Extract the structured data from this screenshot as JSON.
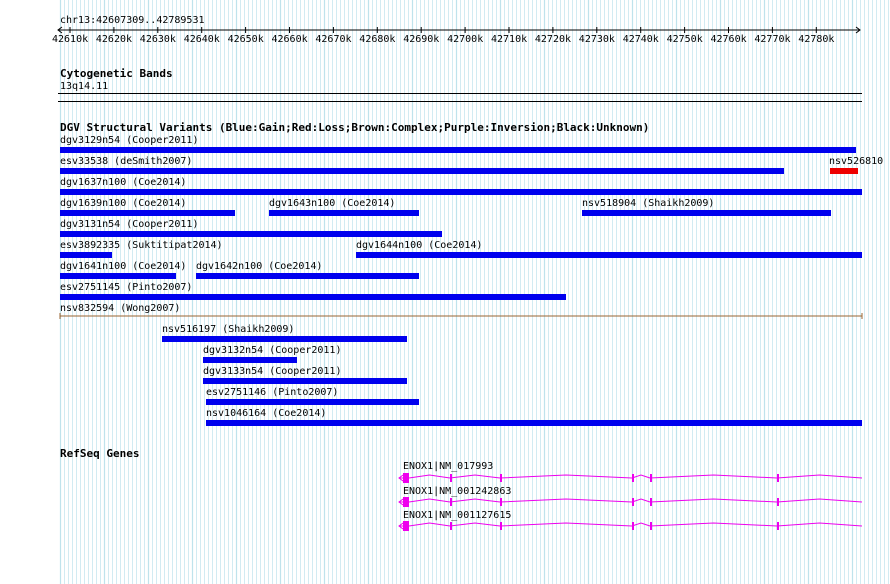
{
  "colors": {
    "gain": "#0000ee",
    "loss": "#ee0000",
    "gene": "#ee00ee",
    "grid": "#bfe3ec",
    "ruler": "#000000",
    "span_line": "#996633"
  },
  "ruler": {
    "region": "chr13:42607309..42789531",
    "ticks": [
      "42610k",
      "42620k",
      "42630k",
      "42640k",
      "42650k",
      "42660k",
      "42670k",
      "42680k",
      "42690k",
      "42700k",
      "42710k",
      "42720k",
      "42730k",
      "42740k",
      "42750k",
      "42760k",
      "42770k",
      "42780k"
    ]
  },
  "cytoband": {
    "title": "Cytogenetic Bands",
    "band": "13q14.11"
  },
  "dgv": {
    "title": "DGV Structural Variants (Blue:Gain;Red:Loss;Brown:Complex;Purple:Inversion;Black:Unknown)",
    "variants": [
      {
        "label": "dgv3129n54 (Cooper2011)",
        "type": "gain"
      },
      {
        "label": "esv33538 (deSmith2007)",
        "type": "gain"
      },
      {
        "label": "nsv526810",
        "type": "loss"
      },
      {
        "label": "dgv1637n100 (Coe2014)",
        "type": "gain"
      },
      {
        "label": "dgv1639n100 (Coe2014)",
        "type": "gain"
      },
      {
        "label": "dgv1643n100 (Coe2014)",
        "type": "gain"
      },
      {
        "label": "nsv518904 (Shaikh2009)",
        "type": "gain"
      },
      {
        "label": "dgv3131n54 (Cooper2011)",
        "type": "gain"
      },
      {
        "label": "esv3892335 (Suktitipat2014)",
        "type": "gain"
      },
      {
        "label": "dgv1644n100 (Coe2014)",
        "type": "gain"
      },
      {
        "label": "dgv1641n100 (Coe2014)",
        "type": "gain"
      },
      {
        "label": "dgv1642n100 (Coe2014)",
        "type": "gain"
      },
      {
        "label": "esv2751145 (Pinto2007)",
        "type": "gain"
      },
      {
        "label": "nsv832594 (Wong2007)",
        "type": "complex"
      },
      {
        "label": "nsv516197 (Shaikh2009)",
        "type": "gain"
      },
      {
        "label": "dgv3132n54 (Cooper2011)",
        "type": "gain"
      },
      {
        "label": "dgv3133n54 (Cooper2011)",
        "type": "gain"
      },
      {
        "label": "esv2751146 (Pinto2007)",
        "type": "gain"
      },
      {
        "label": "nsv1046164 (Coe2014)",
        "type": "gain"
      }
    ]
  },
  "refseq": {
    "title": "RefSeq Genes",
    "transcripts": [
      {
        "label": "ENOX1|NM_017993"
      },
      {
        "label": "ENOX1|NM_001242863"
      },
      {
        "label": "ENOX1|NM_001127615"
      }
    ]
  }
}
